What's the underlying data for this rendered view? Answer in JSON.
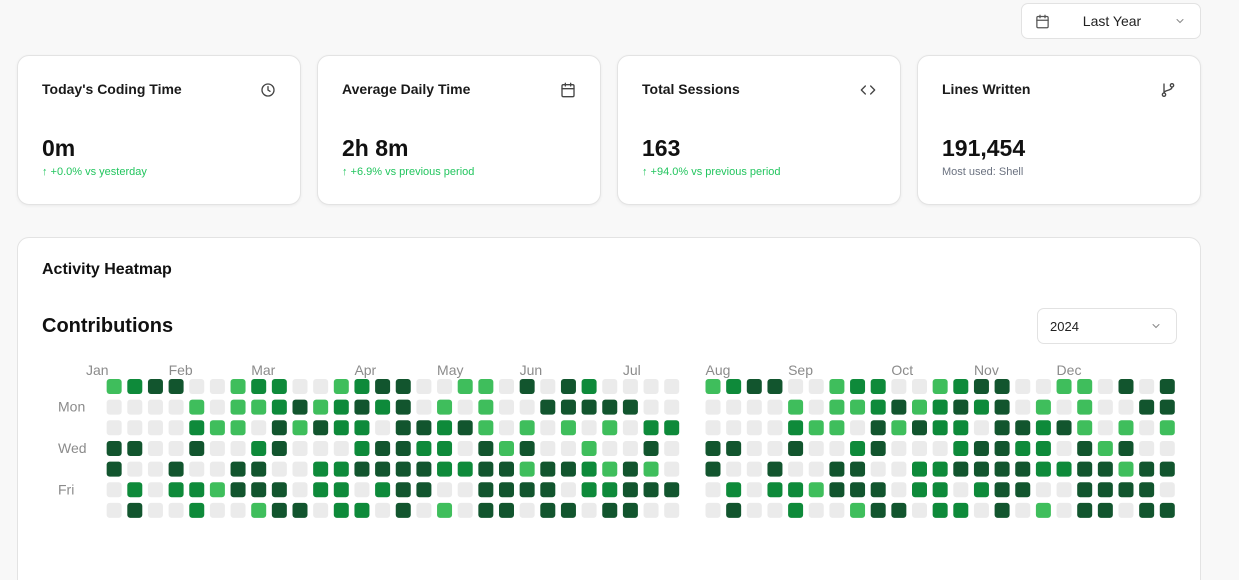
{
  "range_select": {
    "label": "Last Year",
    "icon": "calendar-icon"
  },
  "stats": [
    {
      "title": "Today's Coding Time",
      "icon": "clock-icon",
      "value": "0m",
      "sub": "↑ +0.0% vs yesterday",
      "sub_style": "positive"
    },
    {
      "title": "Average Daily Time",
      "icon": "calendar-icon",
      "value": "2h 8m",
      "sub": "↑ +6.9% vs previous period",
      "sub_style": "positive"
    },
    {
      "title": "Total Sessions",
      "icon": "code-icon",
      "value": "163",
      "sub": "↑ +94.0% vs previous period",
      "sub_style": "positive"
    },
    {
      "title": "Lines Written",
      "icon": "git-branch-icon",
      "value": "191,454",
      "sub": "Most used: Shell",
      "sub_style": "muted"
    }
  ],
  "heatmap": {
    "card_title": "Activity Heatmap",
    "section_title": "Contributions",
    "year": "2024",
    "months": [
      "Jan",
      "Feb",
      "Mar",
      "Apr",
      "May",
      "Jun",
      "Jul",
      "Aug",
      "Sep",
      "Oct",
      "Nov",
      "Dec"
    ],
    "month_weeks": [
      0,
      4,
      8,
      13,
      17,
      21,
      26,
      30,
      34,
      39,
      43,
      47
    ],
    "day_labels": [
      "Mon",
      "Wed",
      "Fri"
    ],
    "day_label_rows": [
      1,
      3,
      5
    ],
    "colors": [
      "#ebebeb",
      "#3fbe5c",
      "#0e8a3a",
      "#12552e"
    ],
    "weeks": 53,
    "cells": [
      "-1233001220012330011030320000",
      "-0000101123123230101003333300",
      "-0000211031322033231010101022",
      "-3300300230002332203130010030",
      "-3003003300223333223313321310",
      "-0202213330220233003333022333",
      "-0300200133022030103303303300"
    ]
  }
}
